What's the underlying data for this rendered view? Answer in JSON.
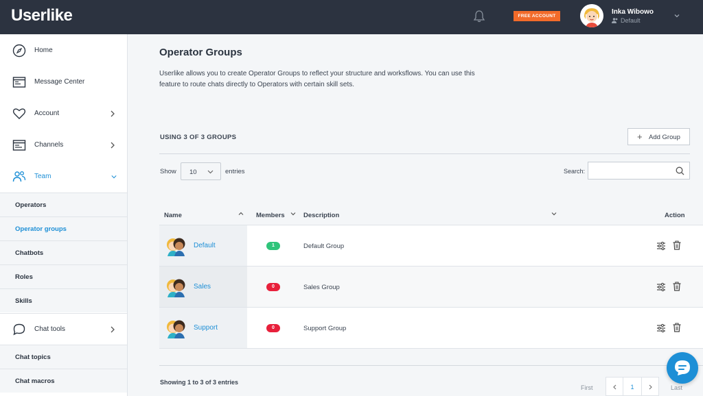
{
  "app": {
    "logo": "Userlike"
  },
  "header": {
    "badge": "FREE ACCOUNT",
    "user_name": "Inka Wibowo",
    "user_role": "Default"
  },
  "sidebar": {
    "items": [
      {
        "label": "Home",
        "icon": "compass-icon"
      },
      {
        "label": "Message Center",
        "icon": "inbox-icon"
      },
      {
        "label": "Account",
        "icon": "heart-icon"
      },
      {
        "label": "Channels",
        "icon": "window-icon"
      },
      {
        "label": "Team",
        "icon": "team-icon"
      }
    ],
    "team_sub": [
      "Operators",
      "Operator groups",
      "Chatbots",
      "Roles",
      "Skills"
    ],
    "chat_tools": {
      "label": "Chat tools",
      "icon": "chat-bubble-icon"
    },
    "chat_sub": [
      "Chat topics",
      "Chat macros"
    ]
  },
  "main": {
    "title": "Operator Groups",
    "description": "Userlike allows you to create Operator Groups to reflect your structure and worksflows. You can use this feature to route chats directly to Operators with certain skill sets.",
    "usage": "USING 3 OF 3 GROUPS",
    "add_button": "Add Group",
    "show_label": "Show",
    "show_value": "10",
    "entries_label": "entries",
    "search_label": "Search:",
    "search_value": "",
    "columns": [
      "Name",
      "Members",
      "Description",
      "Action"
    ],
    "rows": [
      {
        "name": "Default",
        "members": "1",
        "description": "Default Group"
      },
      {
        "name": "Sales",
        "members": "0",
        "description": "Sales Group"
      },
      {
        "name": "Support",
        "members": "0",
        "description": "Support Group"
      }
    ],
    "showing": "Showing 1 to 3 of 3 entries",
    "pagination": {
      "first": "First",
      "current": "1",
      "last": "Last"
    }
  },
  "colors": {
    "accent": "#1d8fd6",
    "topbar": "#2c3340",
    "badge_orange": "#f26b2a",
    "green": "#2fc47a",
    "red": "#e8203b"
  }
}
